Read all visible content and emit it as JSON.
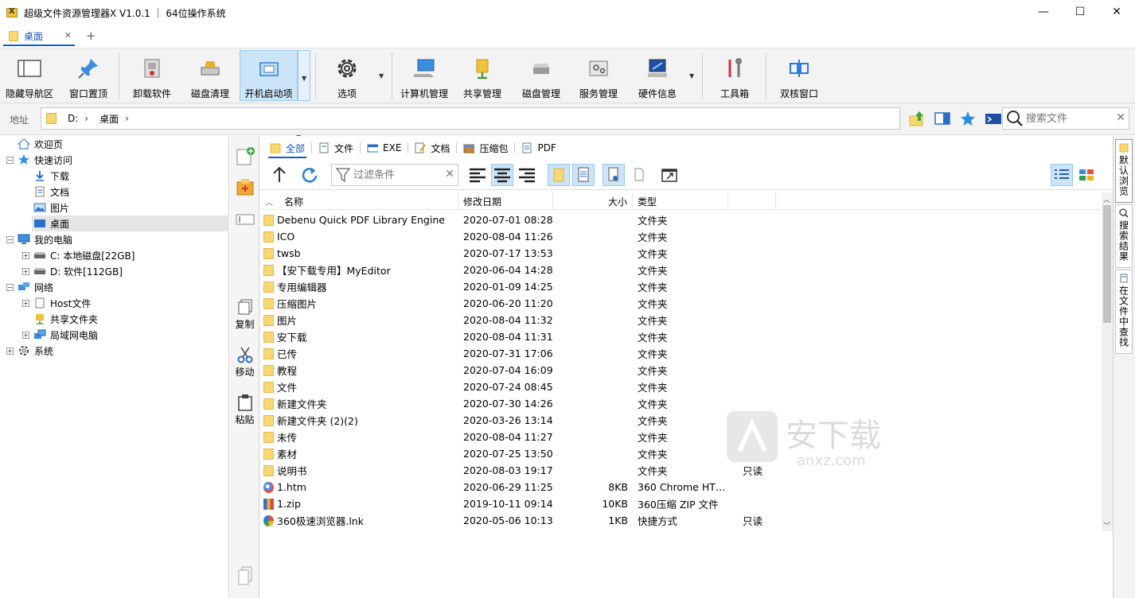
{
  "window": {
    "title": "超级文件资源管理器X V1.0.1 ｜ 64位操作系统",
    "minimize": "—",
    "maximize": "☐",
    "close": "✕"
  },
  "tabs": {
    "items": [
      {
        "label": "桌面",
        "close": "✕"
      }
    ],
    "add": "+"
  },
  "ribbon": {
    "items": [
      {
        "label": "隐藏导航区",
        "icon": "panel-icon"
      },
      {
        "label": "窗口置顶",
        "icon": "pin-icon"
      },
      {
        "label": "卸载软件",
        "icon": "uninstall-icon"
      },
      {
        "label": "磁盘清理",
        "icon": "disk-cleanup-icon"
      },
      {
        "label": "开机启动项",
        "icon": "startup-icon"
      },
      {
        "label": "选项",
        "icon": "gear-icon"
      },
      {
        "label": "计算机管理",
        "icon": "computer-icon"
      },
      {
        "label": "共享管理",
        "icon": "share-icon"
      },
      {
        "label": "磁盘管理",
        "icon": "disk-icon"
      },
      {
        "label": "服务管理",
        "icon": "service-icon"
      },
      {
        "label": "硬件信息",
        "icon": "hardware-icon"
      },
      {
        "label": "工具箱",
        "icon": "toolbox-icon"
      },
      {
        "label": "双核窗口",
        "icon": "dual-window-icon"
      }
    ]
  },
  "address": {
    "label": "地址",
    "crumbs": [
      "D:",
      "桌面"
    ],
    "search_placeholder": "搜索文件"
  },
  "nav": {
    "items": [
      {
        "label": "欢迎页"
      },
      {
        "label": "快速访问"
      },
      {
        "label": "下载"
      },
      {
        "label": "文档"
      },
      {
        "label": "图片"
      },
      {
        "label": "桌面"
      },
      {
        "label": "我的电脑"
      },
      {
        "label": "C: 本地磁盘[22GB]"
      },
      {
        "label": "D: 软件[112GB]"
      },
      {
        "label": "网络"
      },
      {
        "label": "Host文件"
      },
      {
        "label": "共享文件夹"
      },
      {
        "label": "局域网电脑"
      },
      {
        "label": "系统"
      }
    ]
  },
  "side": {
    "copy": "复制",
    "move": "移动",
    "paste": "粘贴"
  },
  "filter_tabs": [
    "全部",
    "文件",
    "EXE",
    "文档",
    "压缩包",
    "PDF"
  ],
  "filter_placeholder": "过滤条件",
  "columns": {
    "name": "名称",
    "date": "修改日期",
    "size": "大小",
    "type": "类型"
  },
  "files": [
    {
      "name": "Debenu Quick PDF Library Engine",
      "date": "2020-07-01 08:28",
      "size": "",
      "type": "文件夹",
      "attr": "",
      "kind": "folder"
    },
    {
      "name": "ICO",
      "date": "2020-08-04 11:26",
      "size": "",
      "type": "文件夹",
      "attr": "",
      "kind": "folder"
    },
    {
      "name": "twsb",
      "date": "2020-07-17 13:53",
      "size": "",
      "type": "文件夹",
      "attr": "",
      "kind": "folder"
    },
    {
      "name": "【安下载专用】MyEditor",
      "date": "2020-06-04 14:28",
      "size": "",
      "type": "文件夹",
      "attr": "",
      "kind": "folder"
    },
    {
      "name": "专用编辑器",
      "date": "2020-01-09 14:25",
      "size": "",
      "type": "文件夹",
      "attr": "",
      "kind": "folder"
    },
    {
      "name": "压缩图片",
      "date": "2020-06-20 11:20",
      "size": "",
      "type": "文件夹",
      "attr": "",
      "kind": "folder"
    },
    {
      "name": "图片",
      "date": "2020-08-04 11:32",
      "size": "",
      "type": "文件夹",
      "attr": "",
      "kind": "folder"
    },
    {
      "name": "安下载",
      "date": "2020-08-04 11:31",
      "size": "",
      "type": "文件夹",
      "attr": "",
      "kind": "folder"
    },
    {
      "name": "已传",
      "date": "2020-07-31 17:06",
      "size": "",
      "type": "文件夹",
      "attr": "",
      "kind": "folder"
    },
    {
      "name": "教程",
      "date": "2020-07-04 16:09",
      "size": "",
      "type": "文件夹",
      "attr": "",
      "kind": "folder"
    },
    {
      "name": "文件",
      "date": "2020-07-24 08:45",
      "size": "",
      "type": "文件夹",
      "attr": "",
      "kind": "folder"
    },
    {
      "name": "新建文件夹",
      "date": "2020-07-30 14:26",
      "size": "",
      "type": "文件夹",
      "attr": "",
      "kind": "folder"
    },
    {
      "name": "新建文件夹 (2)(2)",
      "date": "2020-03-26 13:14",
      "size": "",
      "type": "文件夹",
      "attr": "",
      "kind": "folder"
    },
    {
      "name": "未传",
      "date": "2020-08-04 11:27",
      "size": "",
      "type": "文件夹",
      "attr": "",
      "kind": "folder"
    },
    {
      "name": "素材",
      "date": "2020-07-25 13:50",
      "size": "",
      "type": "文件夹",
      "attr": "",
      "kind": "folder"
    },
    {
      "name": "说明书",
      "date": "2020-08-03 19:17",
      "size": "",
      "type": "文件夹",
      "attr": "只读",
      "kind": "folder"
    },
    {
      "name": "1.htm",
      "date": "2020-06-29 11:25",
      "size": "8KB",
      "type": "360 Chrome HT…",
      "attr": "",
      "kind": "htm"
    },
    {
      "name": "1.zip",
      "date": "2019-10-11 09:14",
      "size": "10KB",
      "type": "360压缩 ZIP 文件",
      "attr": "",
      "kind": "zip"
    },
    {
      "name": "360极速浏览器.lnk",
      "date": "2020-05-06 10:13",
      "size": "1KB",
      "type": "快捷方式",
      "attr": "只读",
      "kind": "lnk"
    }
  ],
  "right_tabs": [
    "默认浏览",
    "搜索结果",
    "在文件中查找"
  ],
  "watermark": {
    "text": "安下载",
    "sub": "anxz.com"
  },
  "colors": {
    "accent": "#1a56c4",
    "selected": "#cce4f7",
    "folder": "#f8d775"
  }
}
